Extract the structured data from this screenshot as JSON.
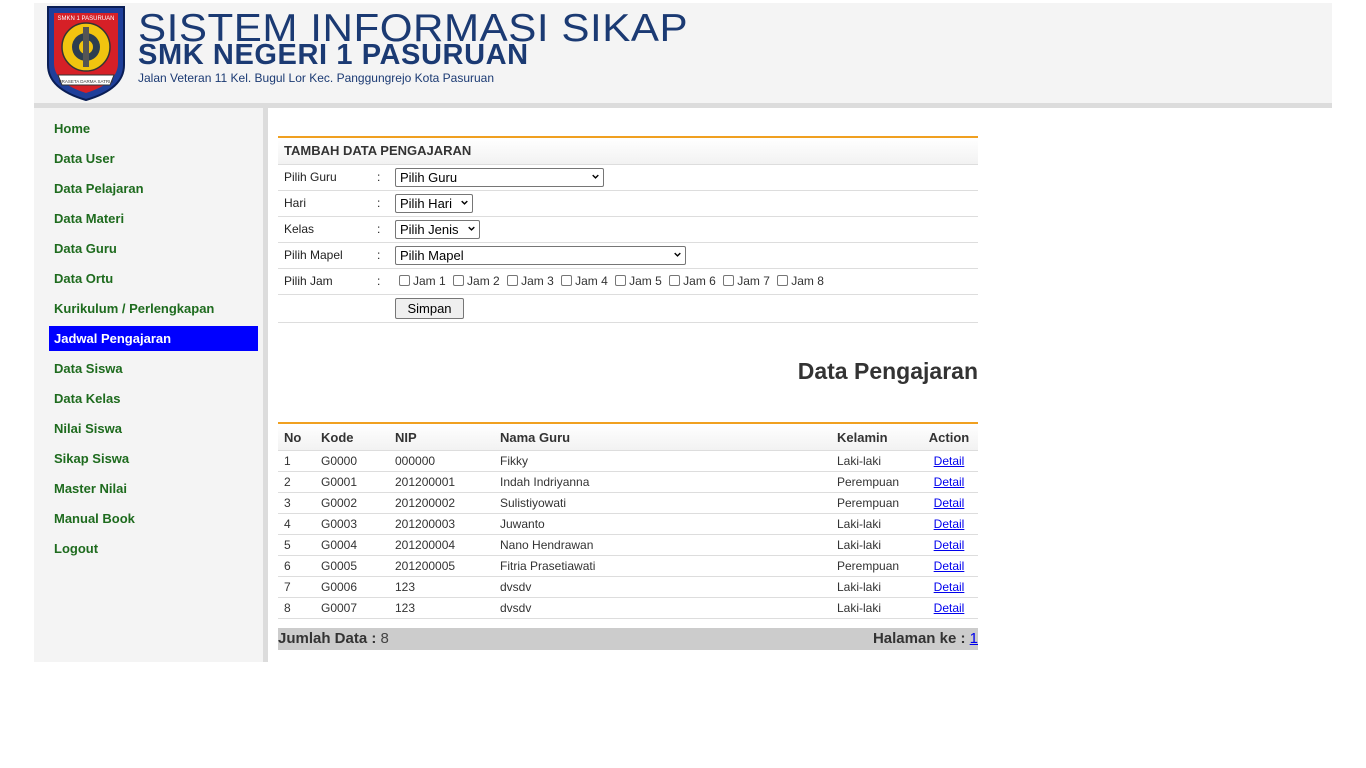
{
  "header": {
    "title": "SISTEM INFORMASI SIKAP",
    "subtitle": "SMK NEGERI 1 PASURUAN",
    "address": "Jalan Veteran 11 Kel. Bugul Lor Kec. Panggungrejo Kota Pasuruan",
    "logo_text_top": "SMKN 1 PASURUAN",
    "logo_text_bottom": "PRASETA DARMA SATRIA"
  },
  "sidebar": {
    "items": [
      {
        "label": "Home"
      },
      {
        "label": "Data User"
      },
      {
        "label": "Data Pelajaran"
      },
      {
        "label": "Data Materi"
      },
      {
        "label": "Data Guru"
      },
      {
        "label": "Data Ortu"
      },
      {
        "label": "Kurikulum / Perlengkapan"
      },
      {
        "label": "Jadwal Pengajaran",
        "active": true
      },
      {
        "label": "Data Siswa"
      },
      {
        "label": "Data Kelas"
      },
      {
        "label": "Nilai Siswa"
      },
      {
        "label": "Sikap Siswa"
      },
      {
        "label": "Master Nilai"
      },
      {
        "label": "Manual Book"
      },
      {
        "label": "Logout"
      }
    ]
  },
  "form": {
    "title": "TAMBAH DATA PENGAJARAN",
    "separator": ":",
    "guru_label": "Pilih Guru",
    "guru_value": "Pilih Guru",
    "hari_label": "Hari",
    "hari_value": "Pilih Hari",
    "kelas_label": "Kelas",
    "kelas_value": "Pilih Jenis",
    "mapel_label": "Pilih Mapel",
    "mapel_value": "Pilih Mapel",
    "jam_label": "Pilih Jam",
    "jam_options": [
      "Jam 1",
      "Jam 2",
      "Jam 3",
      "Jam 4",
      "Jam 5",
      "Jam 6",
      "Jam 7",
      "Jam 8"
    ],
    "submit_label": "Simpan"
  },
  "table": {
    "section_title": "Data Pengajaran",
    "headers": [
      "No",
      "Kode",
      "NIP",
      "Nama Guru",
      "Kelamin",
      "Action"
    ],
    "rows": [
      {
        "no": "1",
        "kode": "G0000",
        "nip": "000000",
        "nama": "Fikky",
        "kelamin": "Laki-laki",
        "action": "Detail"
      },
      {
        "no": "2",
        "kode": "G0001",
        "nip": "201200001",
        "nama": "Indah Indriyanna",
        "kelamin": "Perempuan",
        "action": "Detail"
      },
      {
        "no": "3",
        "kode": "G0002",
        "nip": "201200002",
        "nama": "Sulistiyowati",
        "kelamin": "Perempuan",
        "action": "Detail"
      },
      {
        "no": "4",
        "kode": "G0003",
        "nip": "201200003",
        "nama": "Juwanto",
        "kelamin": "Laki-laki",
        "action": "Detail"
      },
      {
        "no": "5",
        "kode": "G0004",
        "nip": "201200004",
        "nama": "Nano Hendrawan",
        "kelamin": "Laki-laki",
        "action": "Detail"
      },
      {
        "no": "6",
        "kode": "G0005",
        "nip": "201200005",
        "nama": "Fitria Prasetiawati",
        "kelamin": "Perempuan",
        "action": "Detail"
      },
      {
        "no": "7",
        "kode": "G0006",
        "nip": "123",
        "nama": "dvsdv",
        "kelamin": "Laki-laki",
        "action": "Detail"
      },
      {
        "no": "8",
        "kode": "G0007",
        "nip": "123",
        "nama": "dvsdv",
        "kelamin": "Laki-laki",
        "action": "Detail"
      }
    ]
  },
  "footer": {
    "count_label": "Jumlah Data :",
    "count_value": "8",
    "page_label": "Halaman ke :",
    "page_value": "1"
  },
  "colors": {
    "accent_orange": "#f0a020",
    "nav_green": "#1e6b1e",
    "active_blue": "#0000ff",
    "title_navy": "#1b3a73"
  }
}
